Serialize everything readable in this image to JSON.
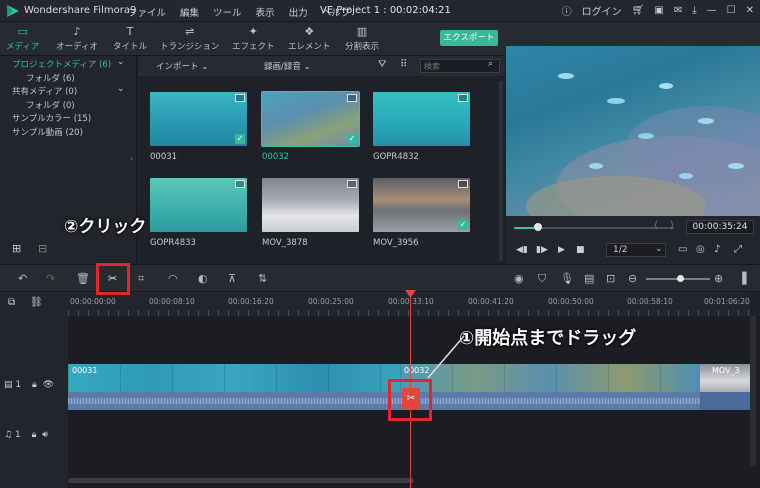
{
  "titlebar": {
    "app_name": "Wondershare Filmora9",
    "menu": [
      "ファイル",
      "編集",
      "ツール",
      "表示",
      "出力",
      "ヘルプ"
    ],
    "project": "VE Project 1 : 00:02:04:21",
    "login": "ログイン"
  },
  "toolbar": {
    "tabs": [
      {
        "label": "メディア",
        "icon": "folder-icon"
      },
      {
        "label": "オーディオ",
        "icon": "music-note-icon"
      },
      {
        "label": "タイトル",
        "icon": "text-icon"
      },
      {
        "label": "トランジション",
        "icon": "transition-icon"
      },
      {
        "label": "エフェクト",
        "icon": "effect-icon"
      },
      {
        "label": "エレメント",
        "icon": "element-icon"
      },
      {
        "label": "分割表示",
        "icon": "split-screen-icon"
      }
    ],
    "export_label": "エクスポート"
  },
  "sidebar": {
    "items": [
      {
        "label": "プロジェクトメディア (6)",
        "selected": true
      },
      {
        "label": "フォルダ (6)"
      },
      {
        "label": "共有メディア (0)"
      },
      {
        "label": "フォルダ (0)"
      },
      {
        "label": "サンプルカラー (15)"
      },
      {
        "label": "サンプル動画 (20)"
      }
    ]
  },
  "media_bar": {
    "import_label": "インポート",
    "record_label": "録画/録音",
    "search_placeholder": "検索"
  },
  "media": [
    {
      "name": "00031",
      "selected": false
    },
    {
      "name": "00032",
      "selected": true
    },
    {
      "name": "GOPR4832",
      "selected": false
    },
    {
      "name": "GOPR4833",
      "selected": false
    },
    {
      "name": "MOV_3878",
      "selected": false
    },
    {
      "name": "MOV_3956",
      "selected": false
    }
  ],
  "preview": {
    "timecode": "00:00:35:24",
    "quality": "1/2",
    "progress": 0.15
  },
  "ruler": {
    "labels": [
      "00:00:00:00",
      "00:00:08:10",
      "00:00:16:20",
      "00:00:25:00",
      "00:00:33:10",
      "00:00:41:20",
      "00:00:50:00",
      "00:00:58:10",
      "00:01:06:20"
    ]
  },
  "timeline": {
    "track1_label": "1",
    "track2_label": "1",
    "clips": [
      "00031",
      "00032",
      "MOV_3"
    ]
  },
  "annotations": {
    "step1": "①開始点までドラッグ",
    "step2": "②クリック"
  },
  "colors": {
    "accent": "#37b89a",
    "callout_red": "#e4262c",
    "playhead": "#e3463f"
  }
}
